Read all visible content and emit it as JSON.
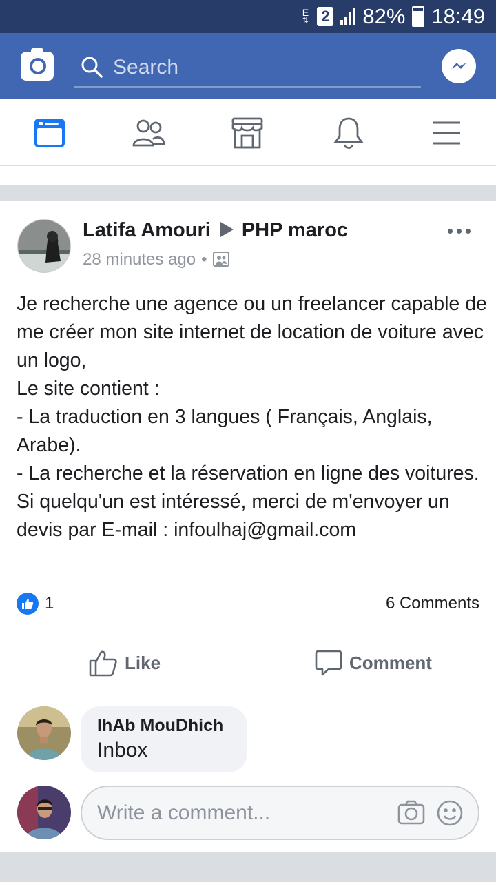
{
  "status": {
    "network_e": "E",
    "sim": "2",
    "battery": "82%",
    "time": "18:49"
  },
  "search": {
    "placeholder": "Search"
  },
  "post": {
    "author": "Latifa Amouri",
    "group": "PHP maroc",
    "time": "28 minutes ago",
    "body": "Je recherche une agence ou un freelancer capable de me créer mon site internet de location de voiture avec un logo,\nLe site contient :\n- La traduction en 3 langues ( Français, Anglais, Arabe).\n- La recherche et la réservation en ligne des voitures.\nSi quelqu'un est intéressé, merci de m'envoyer un devis par E-mail : infoulhaj@gmail.com",
    "like_count": "1",
    "comments_label": "6 Comments",
    "like_label": "Like",
    "comment_label": "Comment"
  },
  "comment": {
    "author": "IhAb MouDhich",
    "text": "Inbox"
  },
  "composer": {
    "placeholder": "Write a comment..."
  },
  "colors": {
    "brand_blue": "#4267b2",
    "status_bar": "#283c69",
    "like_blue": "#1877f2"
  }
}
